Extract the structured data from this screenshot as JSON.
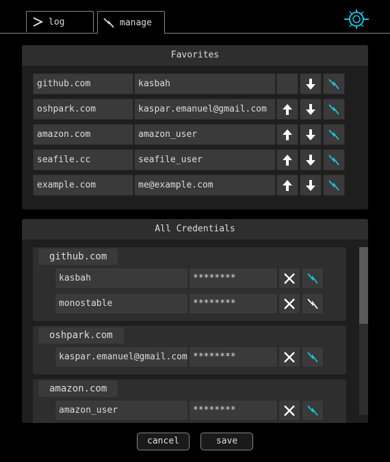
{
  "tabs": {
    "log_label": "log",
    "manage_label": "manage"
  },
  "favorites": {
    "title": "Favorites",
    "rows": [
      {
        "site": "github.com",
        "login": "kasbah",
        "can_move_up": false
      },
      {
        "site": "oshpark.com",
        "login": "kaspar.emanuel@gmail.com",
        "can_move_up": true
      },
      {
        "site": "amazon.com",
        "login": "amazon_user",
        "can_move_up": true
      },
      {
        "site": "seafile.cc",
        "login": "seafile_user",
        "can_move_up": true
      },
      {
        "site": "example.com",
        "login": "me@example.com",
        "can_move_up": true
      }
    ]
  },
  "credentials": {
    "title": "All Credentials",
    "groups": [
      {
        "site": "github.com",
        "entries": [
          {
            "login": "kasbah",
            "password": "********",
            "favorite": true
          },
          {
            "login": "monostable",
            "password": "********",
            "favorite": false
          }
        ]
      },
      {
        "site": "oshpark.com",
        "entries": [
          {
            "login": "kaspar.emanuel@gmail.com",
            "password": "********",
            "favorite": true
          }
        ]
      },
      {
        "site": "amazon.com",
        "entries": [
          {
            "login": "amazon_user",
            "password": "********",
            "favorite": true
          }
        ]
      }
    ]
  },
  "footer": {
    "cancel_label": "cancel",
    "save_label": "save"
  },
  "colors": {
    "accent": "#19c6dc",
    "background": "#000000"
  }
}
